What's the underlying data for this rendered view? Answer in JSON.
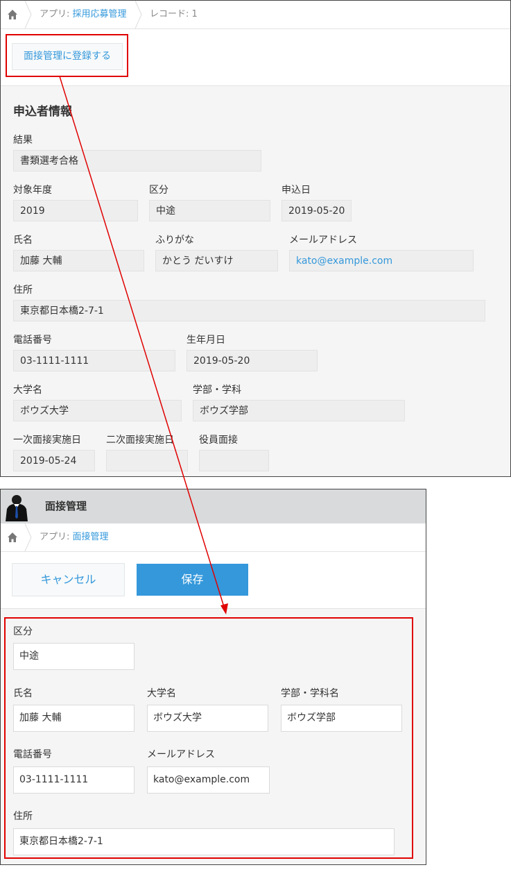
{
  "top": {
    "breadcrumb": {
      "app_prefix": "アプリ: ",
      "app_name": "採用応募管理",
      "record": "レコード: 1"
    },
    "register_button": "面接管理に登録する",
    "section_title": "申込者情報",
    "fields": {
      "result": {
        "label": "結果",
        "value": "書類選考合格"
      },
      "year": {
        "label": "対象年度",
        "value": "2019"
      },
      "category": {
        "label": "区分",
        "value": "中途"
      },
      "apply_date": {
        "label": "申込日",
        "value": "2019-05-20"
      },
      "name": {
        "label": "氏名",
        "value": "加藤 大輔"
      },
      "kana": {
        "label": "ふりがな",
        "value": "かとう だいすけ"
      },
      "email": {
        "label": "メールアドレス",
        "value": "kato@example.com"
      },
      "address": {
        "label": "住所",
        "value": "東京都日本橋2-7-1"
      },
      "phone": {
        "label": "電話番号",
        "value": "03-1111-1111"
      },
      "birthday": {
        "label": "生年月日",
        "value": "2019-05-20"
      },
      "university": {
        "label": "大学名",
        "value": "ボウズ大学"
      },
      "faculty": {
        "label": "学部・学科",
        "value": "ボウズ学部"
      },
      "interview1": {
        "label": "一次面接実施日",
        "value": "2019-05-24"
      },
      "interview2": {
        "label": "二次面接実施日",
        "value": ""
      },
      "exec_interview": {
        "label": "役員面接",
        "value": ""
      }
    }
  },
  "bottom": {
    "app_title": "面接管理",
    "breadcrumb": {
      "app_prefix": "アプリ: ",
      "app_name": "面接管理"
    },
    "cancel_button": "キャンセル",
    "save_button": "保存",
    "fields": {
      "category": {
        "label": "区分",
        "value": "中途"
      },
      "name": {
        "label": "氏名",
        "value": "加藤 大輔"
      },
      "university": {
        "label": "大学名",
        "value": "ボウズ大学"
      },
      "faculty": {
        "label": "学部・学科名",
        "value": "ボウズ学部"
      },
      "phone": {
        "label": "電話番号",
        "value": "03-1111-1111"
      },
      "email": {
        "label": "メールアドレス",
        "value": "kato@example.com"
      },
      "address": {
        "label": "住所",
        "value": "東京都日本橋2-7-1"
      }
    }
  },
  "colors": {
    "link": "#3498db",
    "save_button": "#3498db",
    "annotation": "#e00000",
    "readonly_field": "#eeeeee",
    "form_background": "#f5f5f5"
  },
  "icons": [
    "home-icon",
    "avatar-icon",
    "arrow-icon"
  ]
}
